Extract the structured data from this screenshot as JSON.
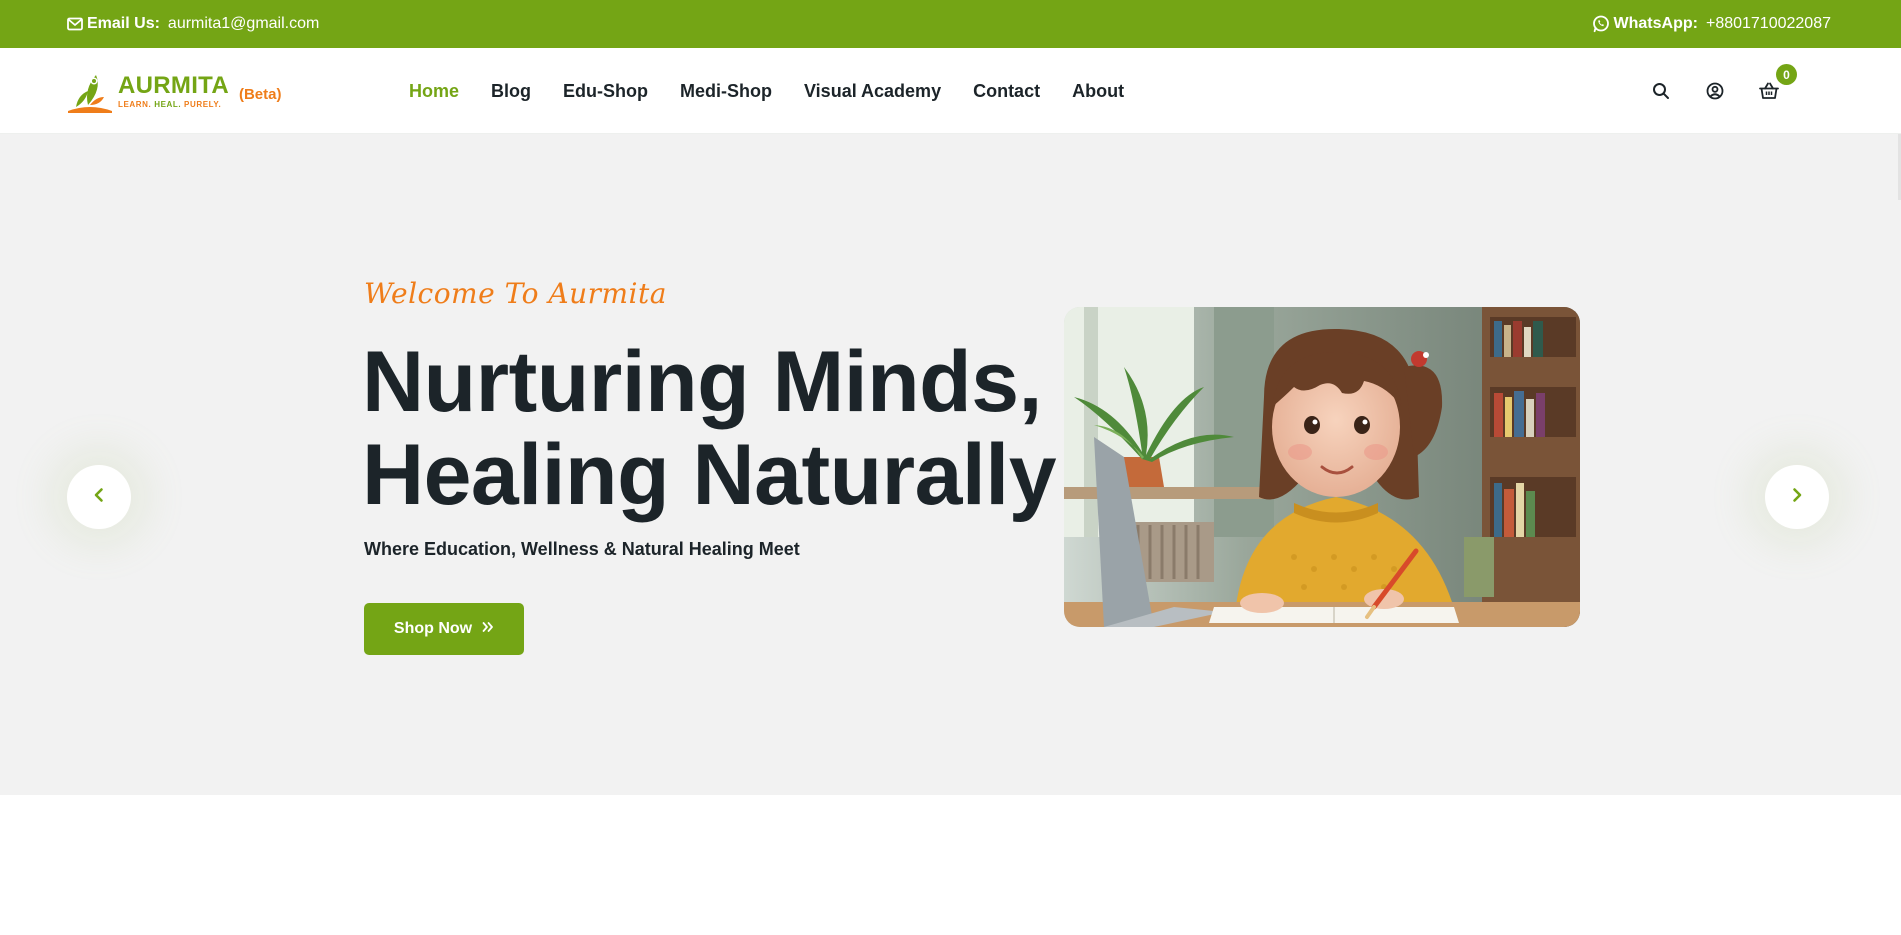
{
  "colors": {
    "brand_green": "#74a515",
    "accent_orange": "#ef7d1a",
    "text_dark": "#1c2429",
    "hero_bg": "#f2f2f2"
  },
  "topbar": {
    "email_icon": "envelope-icon",
    "email_label": "Email Us:",
    "email_value": "aurmita1@gmail.com",
    "whatsapp_icon": "whatsapp-icon",
    "whatsapp_label": "WhatsApp:",
    "whatsapp_value": "+8801710022087"
  },
  "logo": {
    "name": "AURMITA",
    "tagline_learn": "LEARN.",
    "tagline_heal": "HEAL.",
    "tagline_purely": "PURELY.",
    "beta": "(Beta)"
  },
  "nav": {
    "items": [
      {
        "label": "Home",
        "active": true
      },
      {
        "label": "Blog",
        "active": false
      },
      {
        "label": "Edu-Shop",
        "active": false
      },
      {
        "label": "Medi-Shop",
        "active": false
      },
      {
        "label": "Visual Academy",
        "active": false
      },
      {
        "label": "Contact",
        "active": false
      },
      {
        "label": "About",
        "active": false
      }
    ]
  },
  "header_icons": {
    "search": "search-icon",
    "account": "user-circle-icon",
    "cart": "basket-icon",
    "cart_count": "0"
  },
  "hero": {
    "welcome": "Welcome To Aurmita",
    "headline_line1": "Nurturing Minds,",
    "headline_line2": "Healing Naturally",
    "subline": "Where Education, Wellness & Natural Healing Meet",
    "cta_label": "Shop Now",
    "cta_icon": "double-chevron-right-icon",
    "prev_icon": "chevron-left-icon",
    "next_icon": "chevron-right-icon"
  }
}
